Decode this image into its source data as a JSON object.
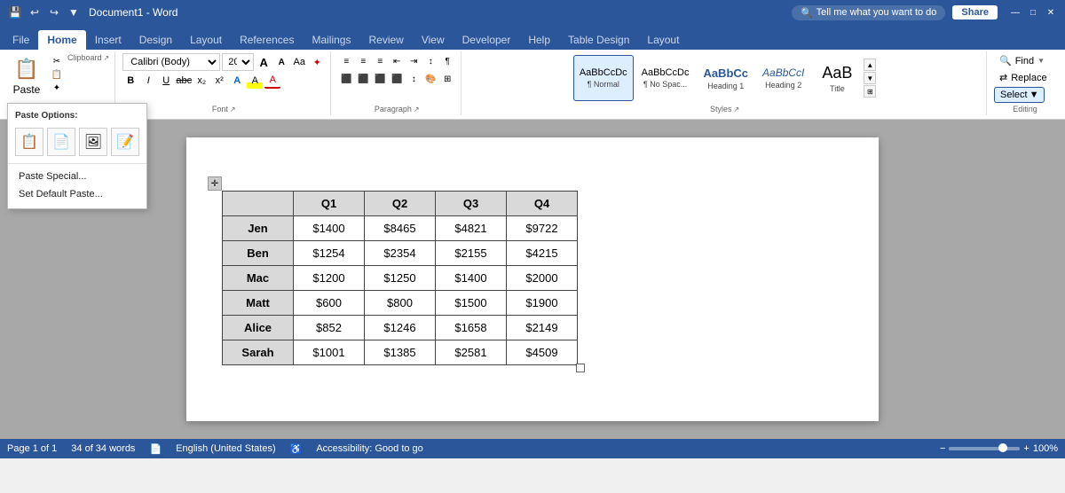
{
  "app": {
    "title": "Document1 - Word",
    "tabs": [
      "File",
      "Home",
      "Insert",
      "Design",
      "Layout",
      "References",
      "Mailings",
      "Review",
      "View",
      "Developer",
      "Help",
      "Table Design",
      "Layout"
    ],
    "active_tab": "Home"
  },
  "quick_access": {
    "buttons": [
      "💾",
      "↩",
      "↪",
      "▼"
    ]
  },
  "ribbon": {
    "clipboard": {
      "label": "Clipboard",
      "paste_label": "Paste",
      "sub_icons": [
        "✂",
        "📋",
        "✦"
      ]
    },
    "font": {
      "label": "Font",
      "font_name": "Calibri (Body)",
      "font_size": "20",
      "grow": "A",
      "shrink": "A",
      "case_btn": "Aa",
      "clear_btn": "✦",
      "bold": "B",
      "italic": "I",
      "underline": "U",
      "strikethrough": "abc",
      "subscript": "x₂",
      "superscript": "x²",
      "font_color": "A",
      "highlight": "A",
      "text_effects": "A"
    },
    "paragraph": {
      "label": "Paragraph",
      "buttons": [
        "≡",
        "≡",
        "≡",
        "≡",
        "≡"
      ]
    },
    "styles": {
      "label": "Styles",
      "items": [
        {
          "label": "¶ Normal",
          "sub": "AaBbCcDc",
          "active": true
        },
        {
          "label": "¶ No Spac...",
          "sub": "AaBbCcDc"
        },
        {
          "label": "Heading 1",
          "sub": "AaBbCc"
        },
        {
          "label": "Heading 2",
          "sub": "AaBbCcI"
        },
        {
          "label": "Title",
          "sub": "AaB"
        }
      ]
    },
    "editing": {
      "label": "Editing",
      "find_label": "Find",
      "replace_label": "Replace",
      "select_label": "Select"
    }
  },
  "paste_popup": {
    "title": "Paste Options:",
    "icons": [
      "📋",
      "📄",
      "🖼",
      "📝"
    ],
    "menu_items": [
      "Paste Special...",
      "Set Default Paste..."
    ]
  },
  "table": {
    "headers": [
      "",
      "Q1",
      "Q2",
      "Q3",
      "Q4"
    ],
    "rows": [
      {
        "name": "Jen",
        "q1": "$1400",
        "q2": "$8465",
        "q3": "$4821",
        "q4": "$9722"
      },
      {
        "name": "Ben",
        "q1": "$1254",
        "q2": "$2354",
        "q3": "$2155",
        "q4": "$4215"
      },
      {
        "name": "Mac",
        "q1": "$1200",
        "q2": "$1250",
        "q3": "$1400",
        "q4": "$2000"
      },
      {
        "name": "Matt",
        "q1": "$600",
        "q2": "$800",
        "q3": "$1500",
        "q4": "$1900"
      },
      {
        "name": "Alice",
        "q1": "$852",
        "q2": "$1246",
        "q3": "$1658",
        "q4": "$2149"
      },
      {
        "name": "Sarah",
        "q1": "$1001",
        "q2": "$1385",
        "q3": "$2581",
        "q4": "$4509"
      }
    ]
  },
  "status_bar": {
    "page": "Page 1 of 1",
    "words": "34 of 34 words",
    "language": "English (United States)",
    "accessibility": "Accessibility: Good to go",
    "zoom": "100%",
    "zoom_value": 70
  }
}
